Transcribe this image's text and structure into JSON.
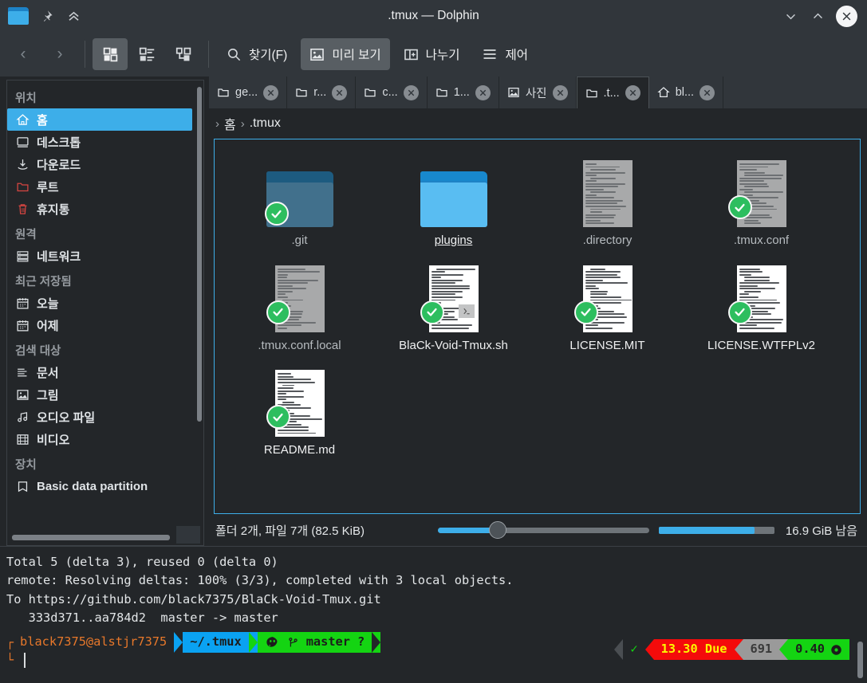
{
  "window": {
    "title": ".tmux — Dolphin",
    "app_icon": "folder-icon",
    "pin_icon": "pin-icon",
    "collapse_icon": "double-chevron-up-icon",
    "minimize_label": "∨",
    "maximize_label": "∧",
    "close_label": "✕"
  },
  "toolbar": {
    "back_label": "‹",
    "forward_label": "›",
    "view_icons": [
      "grid-view-icon",
      "details-view-icon",
      "columns-view-icon"
    ],
    "buttons": [
      {
        "label": "찾기(F)",
        "icon": "search-icon",
        "active": false
      },
      {
        "label": "미리 보기",
        "icon": "preview-icon",
        "active": true
      },
      {
        "label": "나누기",
        "icon": "split-icon",
        "active": false
      },
      {
        "label": "제어",
        "icon": "hamburger-menu-icon",
        "active": false
      }
    ]
  },
  "sidebar": {
    "groups": [
      {
        "title": "위치",
        "items": [
          {
            "label": "홈",
            "icon": "home-icon",
            "selected": true
          },
          {
            "label": "데스크톱",
            "icon": "desktop-icon",
            "selected": false
          },
          {
            "label": "다운로드",
            "icon": "download-icon",
            "selected": false
          },
          {
            "label": "루트",
            "icon": "root-folder-icon",
            "selected": false
          },
          {
            "label": "휴지통",
            "icon": "trash-icon",
            "selected": false
          }
        ]
      },
      {
        "title": "원격",
        "items": [
          {
            "label": "네트워크",
            "icon": "network-icon",
            "selected": false
          }
        ]
      },
      {
        "title": "최근 저장됨",
        "items": [
          {
            "label": "오늘",
            "icon": "calendar-icon",
            "selected": false
          },
          {
            "label": "어제",
            "icon": "calendar-icon",
            "selected": false
          }
        ]
      },
      {
        "title": "검색 대상",
        "items": [
          {
            "label": "문서",
            "icon": "document-icon",
            "selected": false
          },
          {
            "label": "그림",
            "icon": "image-icon",
            "selected": false
          },
          {
            "label": "오디오 파일",
            "icon": "audio-icon",
            "selected": false
          },
          {
            "label": "비디오",
            "icon": "video-icon",
            "selected": false
          }
        ]
      },
      {
        "title": "장치",
        "items": [
          {
            "label": "Basic data partition",
            "icon": "drive-icon",
            "selected": false
          }
        ]
      }
    ]
  },
  "tabs": [
    {
      "label": "ge...",
      "icon": "folder-icon",
      "active": false
    },
    {
      "label": "r...",
      "icon": "folder-icon",
      "active": false
    },
    {
      "label": "c...",
      "icon": "folder-icon",
      "active": false
    },
    {
      "label": "1...",
      "icon": "folder-icon",
      "active": false
    },
    {
      "label": "사진",
      "icon": "image-icon",
      "active": false
    },
    {
      "label": ".t...",
      "icon": "folder-icon",
      "active": true
    },
    {
      "label": "bl...",
      "icon": "home-icon",
      "active": false
    }
  ],
  "breadcrumb": {
    "leading_sep": "›",
    "items": [
      "홈",
      ".tmux"
    ],
    "separator": "›"
  },
  "files": [
    {
      "name": ".git",
      "type": "folder",
      "hidden": true,
      "checked": true,
      "hovered": false
    },
    {
      "name": "plugins",
      "type": "folder",
      "hidden": false,
      "checked": false,
      "hovered": true
    },
    {
      "name": ".directory",
      "type": "document",
      "hidden": true,
      "checked": false,
      "hovered": false
    },
    {
      "name": ".tmux.conf",
      "type": "document",
      "hidden": true,
      "checked": true,
      "hovered": false
    },
    {
      "name": ".tmux.conf.local",
      "type": "document",
      "hidden": true,
      "checked": true,
      "hovered": false
    },
    {
      "name": "BlaCk-Void-Tmux.sh",
      "type": "script",
      "hidden": false,
      "checked": true,
      "hovered": false
    },
    {
      "name": "LICENSE.MIT",
      "type": "document",
      "hidden": false,
      "checked": true,
      "hovered": false
    },
    {
      "name": "LICENSE.WTFPLv2",
      "type": "document",
      "hidden": false,
      "checked": true,
      "hovered": false
    },
    {
      "name": "README.md",
      "type": "document",
      "hidden": false,
      "checked": true,
      "hovered": false
    }
  ],
  "statusbar": {
    "summary": "폴더 2개, 파일 7개 (82.5 KiB)",
    "free_space": "16.9 GiB 남음"
  },
  "terminal": {
    "lines": [
      "Total 5 (delta 3), reused 0 (delta 0)",
      "remote: Resolving deltas: 100% (3/3), completed with 3 local objects.",
      "To https://github.com/black7375/BlaCk-Void-Tmux.git",
      "   333d371..aa784d2  master -> master"
    ],
    "prompt": {
      "marker": "┌",
      "user_host": "black7375@alstjr7375",
      "path": "~/.tmux",
      "git_icon": "octocat-icon",
      "branch_icon": "git-branch-icon",
      "branch": "master",
      "git_status": "?",
      "continuation_marker": "└"
    },
    "right_prompt": {
      "ok_mark": "✓",
      "due": "13.30 Due",
      "count": "691",
      "value": "0.40",
      "value_icon": "record-icon"
    }
  },
  "colors": {
    "accent": "#3daee9",
    "titlebar": "#31363b",
    "background": "#232629",
    "check_green": "#2dbe5f",
    "prompt_orange": "#e8782a",
    "prompt_blue": "#0aa2f2",
    "prompt_green": "#14d412",
    "due_red": "#f40b0b",
    "due_yellow": "#fcf700"
  }
}
